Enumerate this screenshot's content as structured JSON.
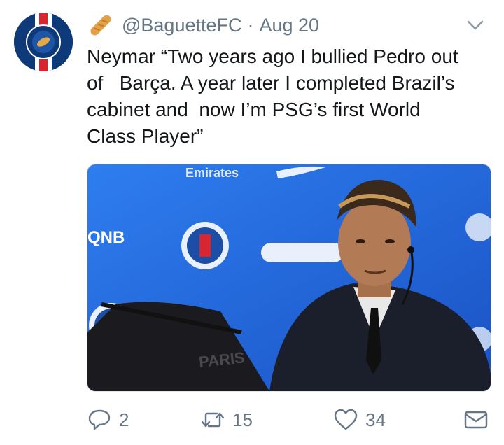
{
  "tweet": {
    "handle": "@BaguetteFC",
    "separator": "·",
    "date": "Aug 20",
    "text": "Neymar “Two years ago I bullied Pedro out\nof   Barça. A year later I completed Brazil’s\ncabinet and  now I’m PSG’s first World\nClass Player”",
    "media": {
      "backdrop_text": [
        "QNB",
        "Emirates",
        "PARIS"
      ],
      "colors": {
        "backdrop": "#1f63d6",
        "suit": "#1b1e2b"
      }
    }
  },
  "actions": {
    "reply_count": "2",
    "retweet_count": "15",
    "like_count": "34"
  },
  "colors": {
    "text": "#14171a",
    "muted": "#657786",
    "avatar_bg": "#0f3a7a",
    "avatar_stripe_red": "#d7262f"
  },
  "icons": [
    "baguette-emoji",
    "chevron-down-icon",
    "reply-icon",
    "retweet-icon",
    "like-icon",
    "direct-message-icon"
  ]
}
